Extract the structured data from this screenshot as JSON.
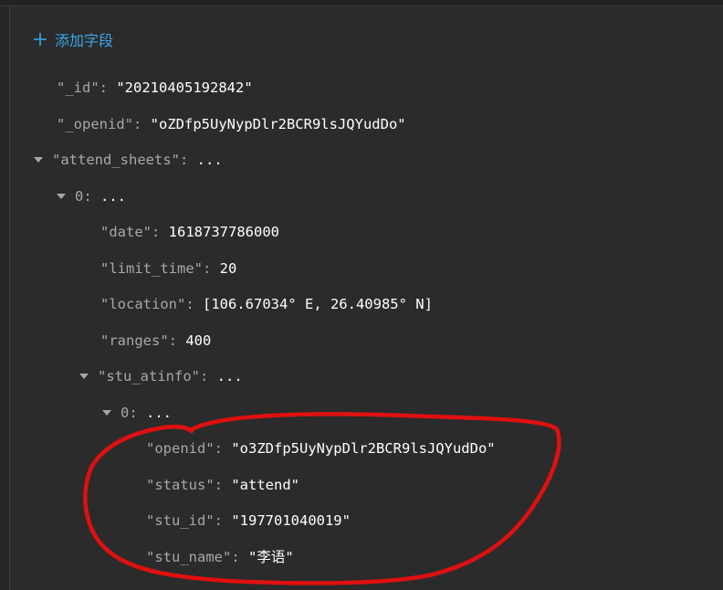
{
  "toolbar": {
    "add_field_label": "添加字段"
  },
  "document": {
    "id": {
      "key": "\"_id\"",
      "value": "\"20210405192842\""
    },
    "openid": {
      "key": "\"_openid\"",
      "value": "\"oZDfp5UyNypDlr2BCR9lsJQYudDo\""
    },
    "attend_sheets": {
      "key": "\"attend_sheets\"",
      "value": "..."
    },
    "sheet0": {
      "key": "0",
      "value": "...",
      "date": {
        "key": "\"date\"",
        "value": "1618737786000"
      },
      "limit_time": {
        "key": "\"limit_time\"",
        "value": "20"
      },
      "location": {
        "key": "\"location\"",
        "value": "[106.67034° E, 26.40985° N]"
      },
      "ranges": {
        "key": "\"ranges\"",
        "value": "400"
      },
      "stu_atinfo": {
        "key": "\"stu_atinfo\"",
        "value": "..."
      },
      "info0": {
        "key": "0",
        "value": "...",
        "openid": {
          "key": "\"openid\"",
          "value": "\"o3ZDfp5UyNypDlr2BCR9lsJQYudDo\""
        },
        "status": {
          "key": "\"status\"",
          "value": "\"attend\""
        },
        "stu_id": {
          "key": "\"stu_id\"",
          "value": "\"197701040019\""
        },
        "stu_name": {
          "key": "\"stu_name\"",
          "value": "\"李语\""
        }
      }
    }
  },
  "colors": {
    "background": "#2b2b2b",
    "accent": "#3aa7e9",
    "key_text": "#a8a8a8",
    "value_text": "#ffffff",
    "annotation": "#e01010"
  },
  "icons": {
    "add": "plus-icon",
    "expand": "caret-down-icon"
  }
}
